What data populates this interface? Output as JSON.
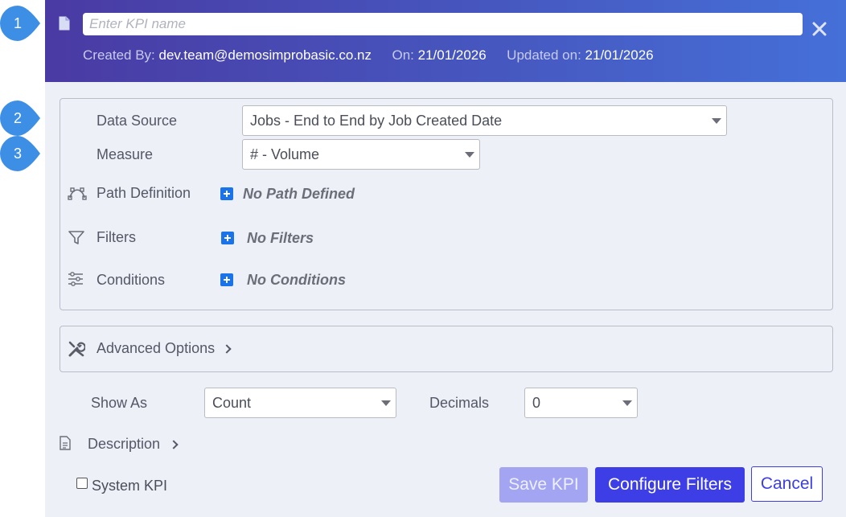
{
  "callouts": [
    "1",
    "2",
    "3"
  ],
  "header": {
    "kpi_name_placeholder": "Enter KPI name",
    "created_by_label": "Created By:",
    "created_by_value": "dev.team@demosimprobasic.co.nz",
    "on_label": "On:",
    "on_value": "21/01/2026",
    "updated_label": "Updated on:",
    "updated_value": "21/01/2026"
  },
  "panel": {
    "data_source_label": "Data Source",
    "data_source_value": "Jobs - End to End by Job Created Date",
    "measure_label": "Measure",
    "measure_value": "# - Volume",
    "path_label": "Path Definition",
    "path_empty": "No Path Defined",
    "filters_label": "Filters",
    "filters_empty": "No Filters",
    "conditions_label": "Conditions",
    "conditions_empty": "No Conditions"
  },
  "advanced": {
    "label": "Advanced Options"
  },
  "display": {
    "show_as_label": "Show As",
    "show_as_value": "Count",
    "decimals_label": "Decimals",
    "decimals_value": "0"
  },
  "description": {
    "label": "Description"
  },
  "footer": {
    "system_kpi_label": "System KPI",
    "save_label": "Save KPI",
    "configure_label": "Configure Filters",
    "cancel_label": "Cancel"
  },
  "colors": {
    "header_start": "#4a3aa3",
    "header_end": "#4570d8",
    "callout": "#3d8fe6",
    "primary": "#3d3ee6",
    "primary_disabled": "#a3a5f2",
    "add_button": "#1a73e8"
  }
}
